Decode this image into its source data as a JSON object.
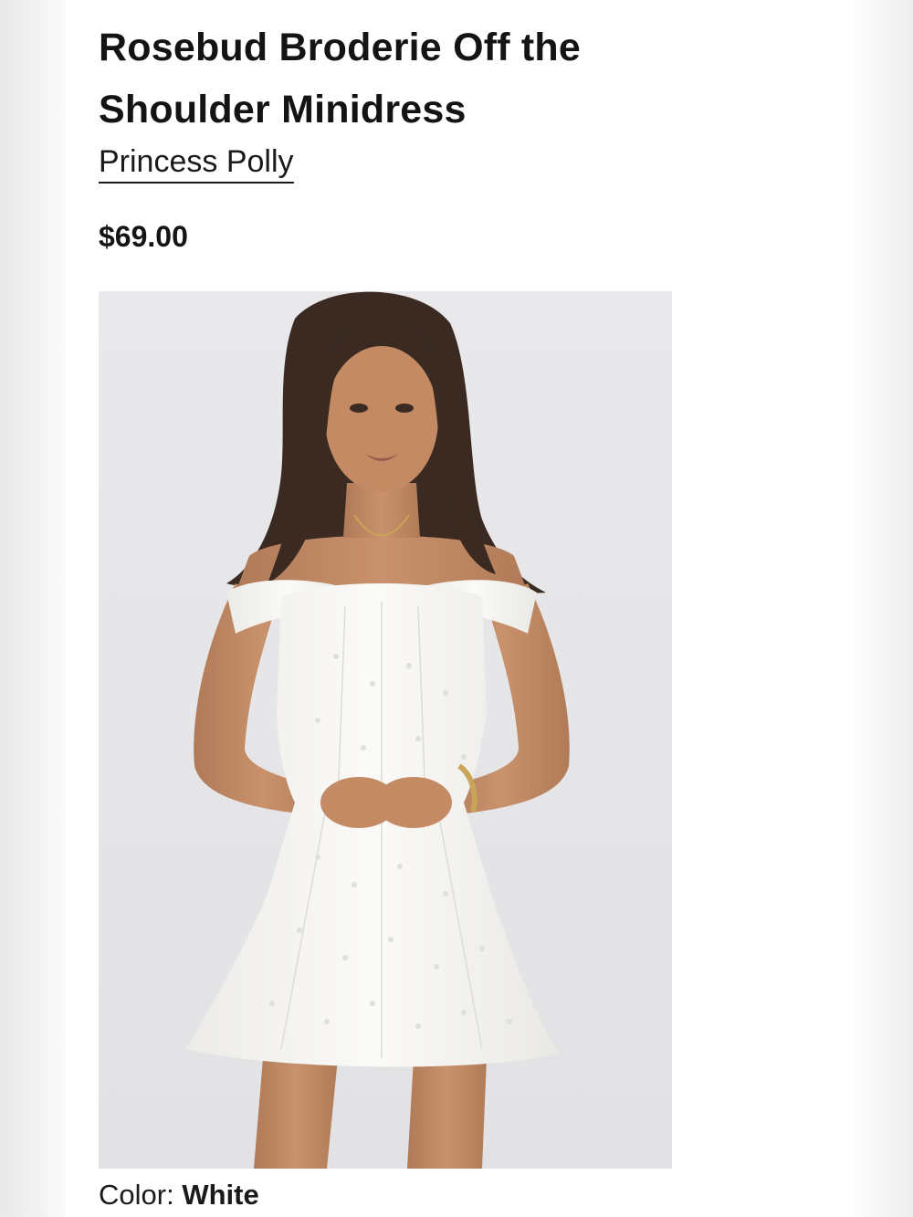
{
  "product": {
    "title": "Rosebud Broderie Off the Shoulder Minidress",
    "brand": "Princess Polly",
    "price": "$69.00",
    "color_label": "Color:",
    "color_value": "White"
  },
  "colors": {
    "text": "#141414",
    "photo_background": "#e8e8ea"
  }
}
